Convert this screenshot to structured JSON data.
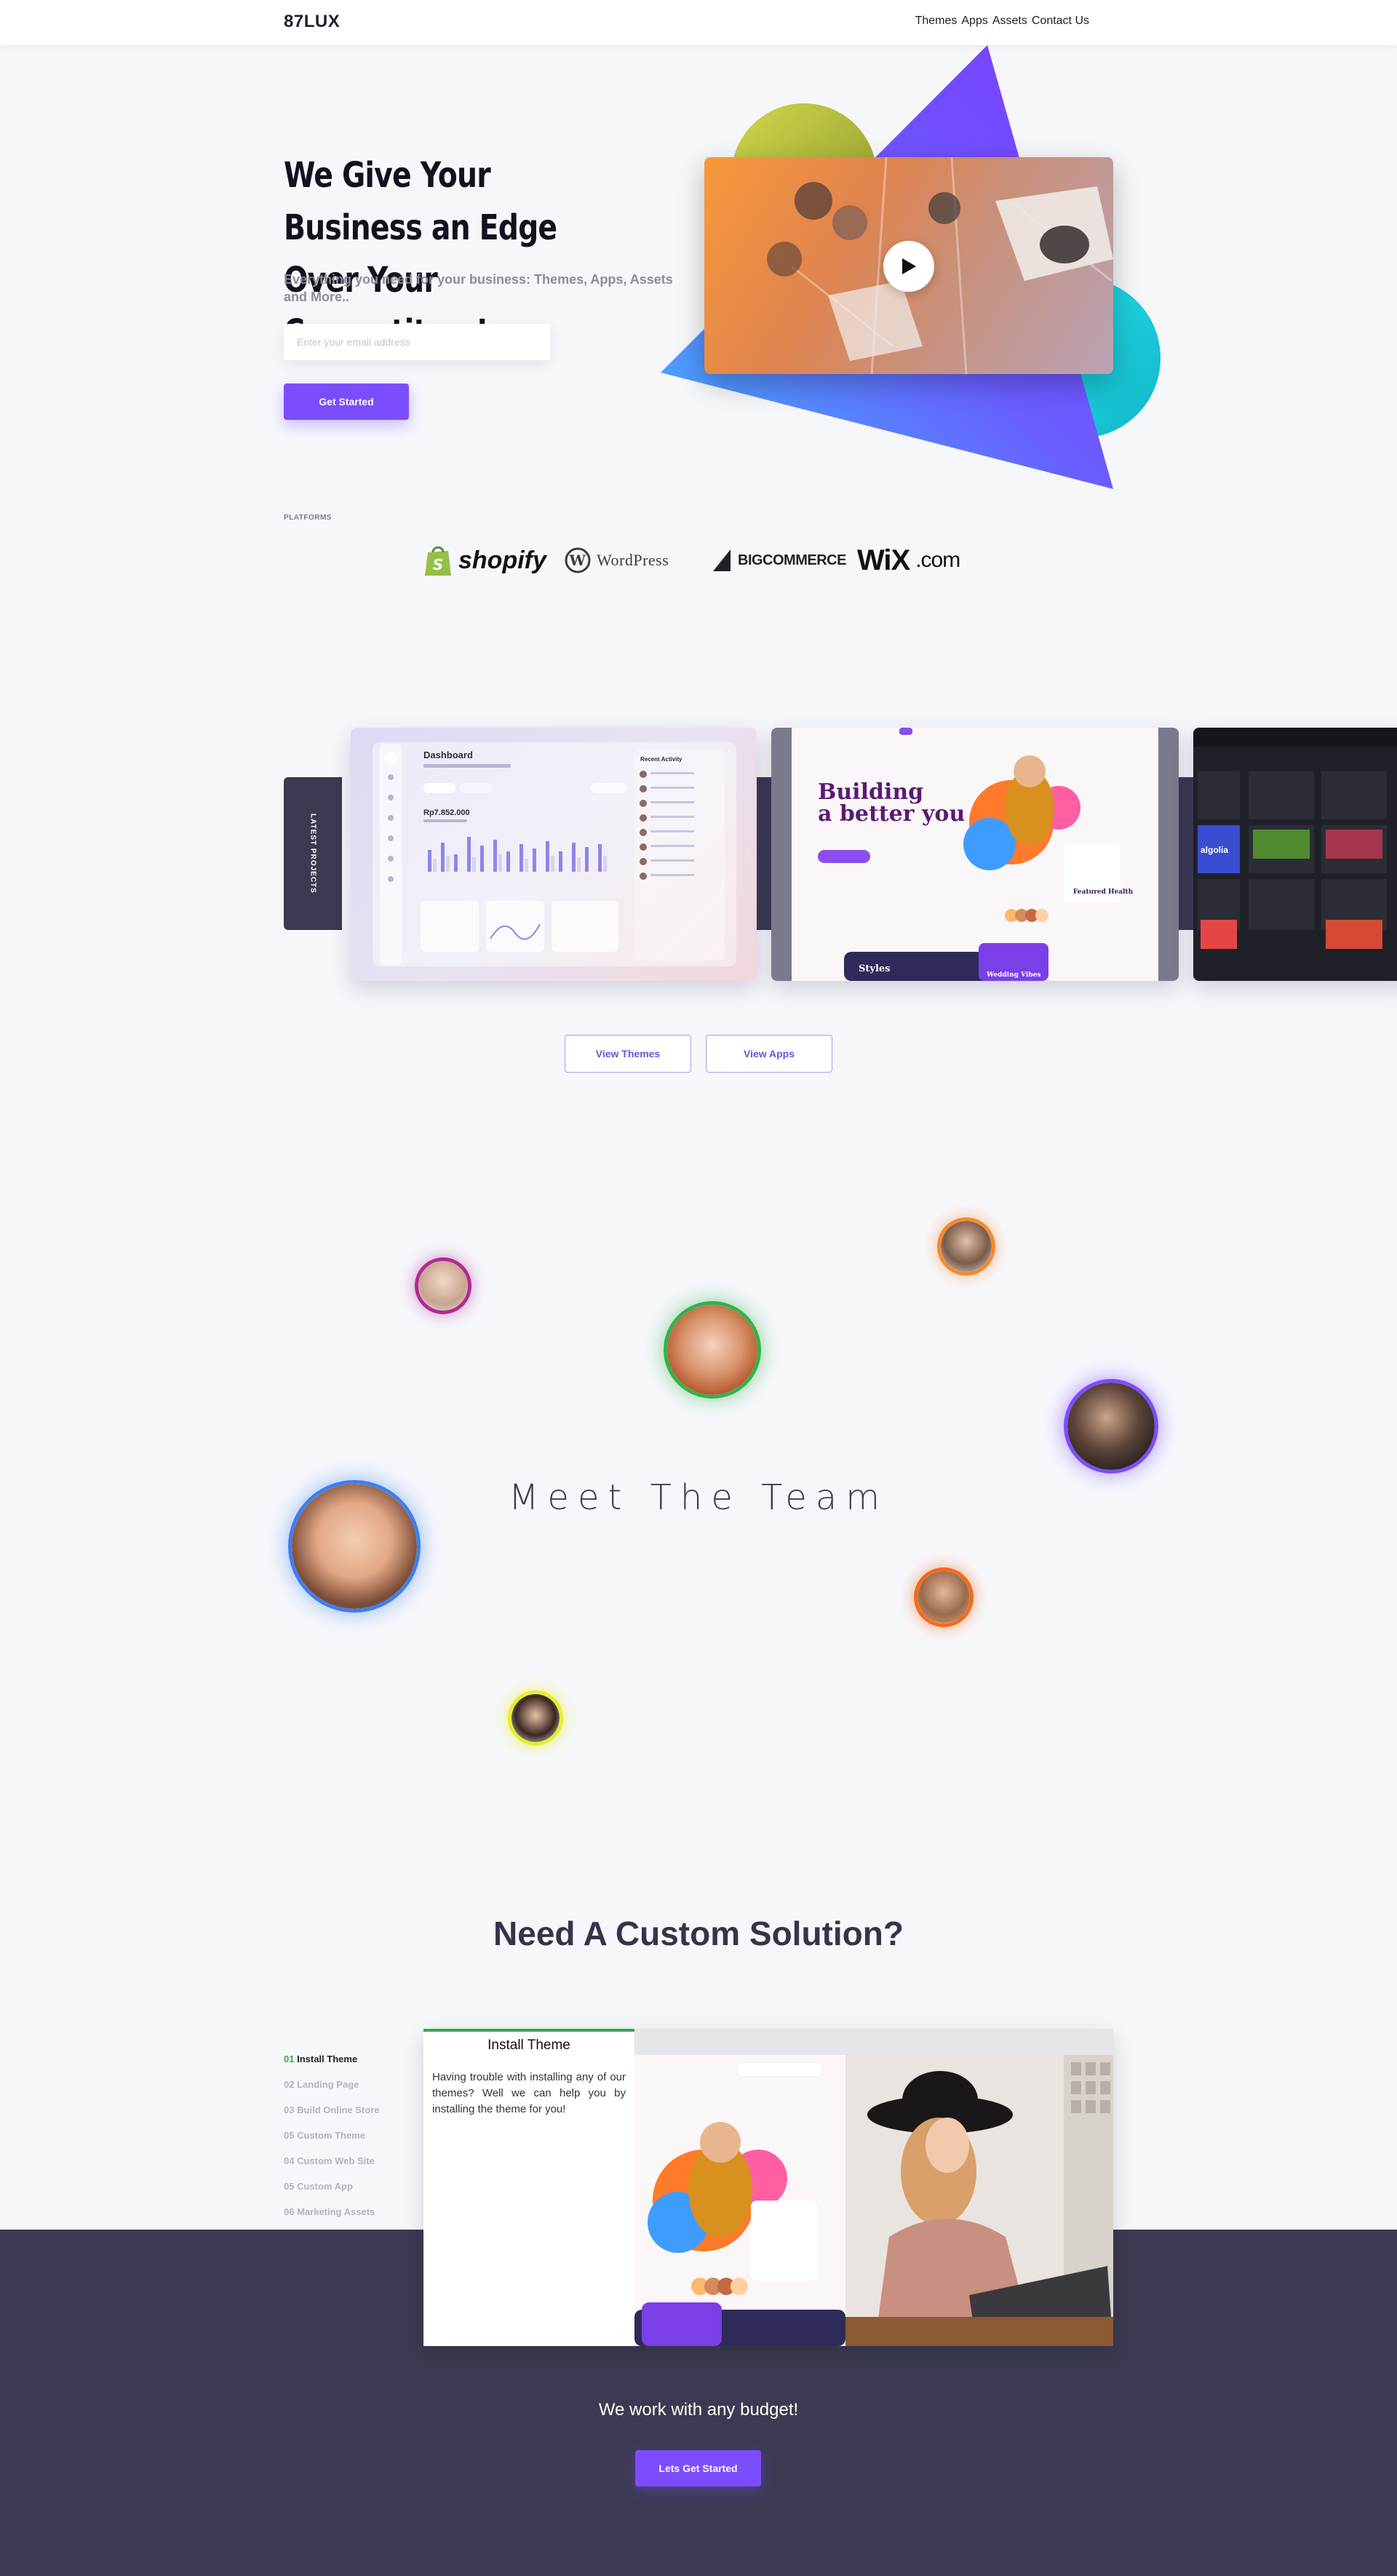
{
  "nav": {
    "brand": "87LUX",
    "links": [
      "Themes",
      "Apps",
      "Assets",
      "Contact Us"
    ]
  },
  "hero": {
    "title": "We Give Your Business an Edge Over Your Competitors!",
    "subtitle": "Everything you need for your business: Themes, Apps, Assets and More..",
    "email_placeholder": "Enter your email address",
    "cta": "Get Started",
    "icons": [
      "play-icon"
    ]
  },
  "platforms": {
    "label": "PLATFORMS",
    "logos": [
      "shopify",
      "WordPress",
      "BIGCOMMERCE",
      "WiX",
      ".com"
    ]
  },
  "projects": {
    "tab_label": "LATEST PROJECTS",
    "card1": {
      "title": "Dashboard",
      "amount": "Rp7.852.000",
      "side_title": "Recent Activity"
    },
    "card2": {
      "headline_1": "Building",
      "headline_2": "a better you",
      "featured": "Featured Health",
      "styles": "Styles",
      "wedding": "Wedding Vibes"
    },
    "card3": {
      "label": "algolia"
    },
    "buttons": [
      "View Themes",
      "View Apps"
    ]
  },
  "team": {
    "title": "Meet The Team",
    "colors": [
      "#b02a93",
      "#32b24a",
      "#f5892e",
      "#7b4dff",
      "#3a7ff0",
      "#f26a1b",
      "#e7ef2b"
    ]
  },
  "custom": {
    "title": "Need A Custom Solution?",
    "steps": [
      {
        "num": "01",
        "label": "Install Theme"
      },
      {
        "num": "02",
        "label": "Landing Page"
      },
      {
        "num": "03",
        "label": "Build Online Store"
      },
      {
        "num": "05",
        "label": "Custom Theme"
      },
      {
        "num": "04",
        "label": "Custom Web Site"
      },
      {
        "num": "05",
        "label": "Custom App"
      },
      {
        "num": "06",
        "label": "Marketing Assets"
      }
    ],
    "panel_title": "Install Theme",
    "panel_text": "Having trouble with installing any of our themes? Well we can help you by installing the theme for you!",
    "budget": "We work with any budget!",
    "cta": "Lets Get Started"
  }
}
